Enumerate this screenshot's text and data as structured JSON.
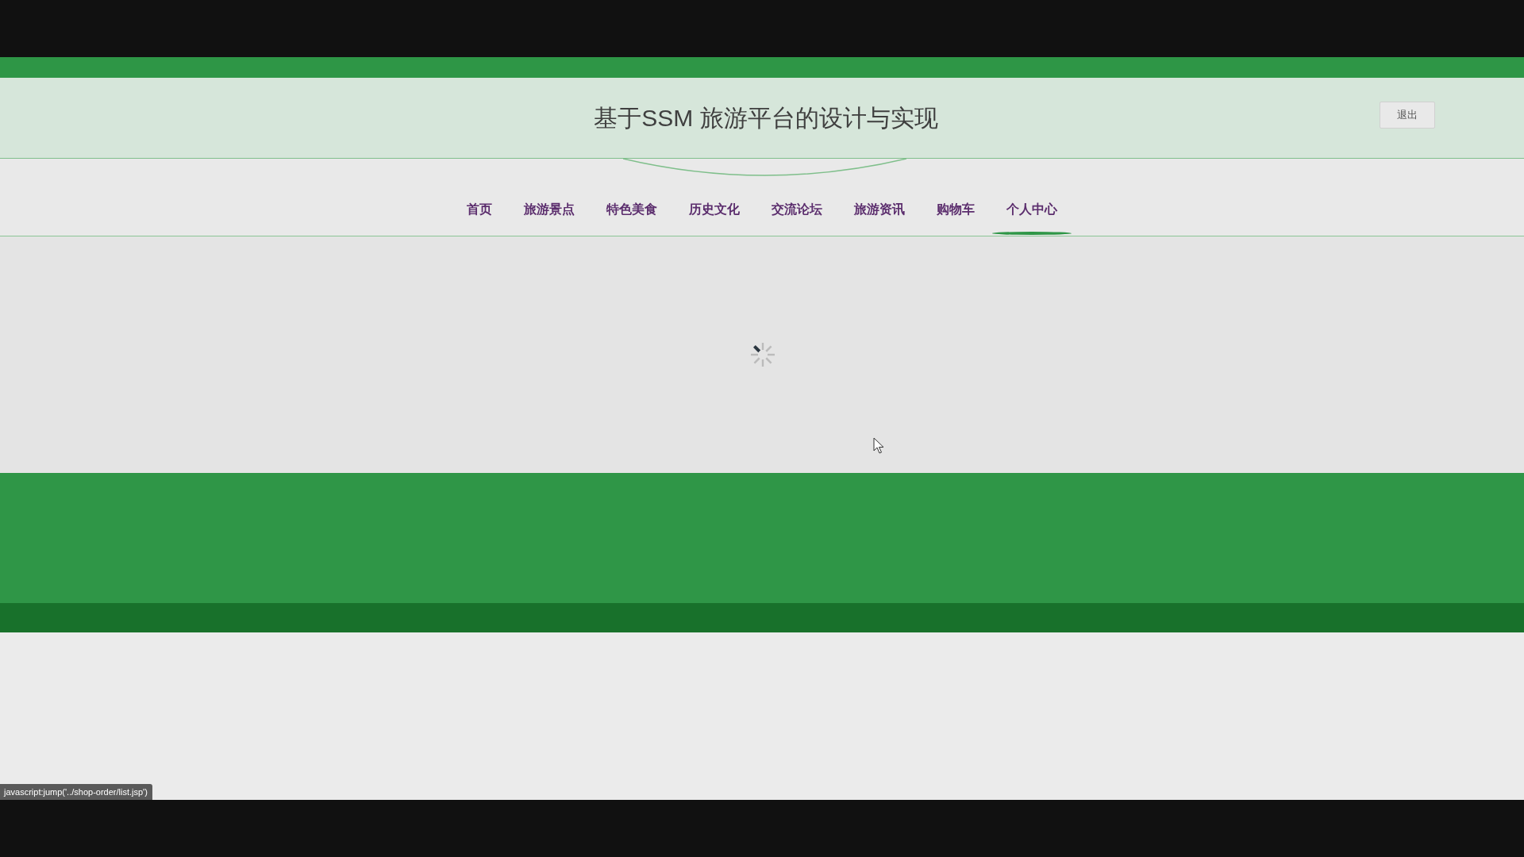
{
  "header": {
    "title": "基于SSM 旅游平台的设计与实现",
    "logout_button": "退出"
  },
  "nav": {
    "items": [
      {
        "label": "首页",
        "selected": false
      },
      {
        "label": "旅游景点",
        "selected": false
      },
      {
        "label": "特色美食",
        "selected": false
      },
      {
        "label": "历史文化",
        "selected": false
      },
      {
        "label": "交流论坛",
        "selected": false
      },
      {
        "label": "旅游资讯",
        "selected": false
      },
      {
        "label": "购物车",
        "selected": false
      },
      {
        "label": "个人中心",
        "selected": true
      }
    ]
  },
  "content": {
    "loading": true
  },
  "status_bar": {
    "url": "javascript:jump('../shop-order/list.jsp')"
  }
}
